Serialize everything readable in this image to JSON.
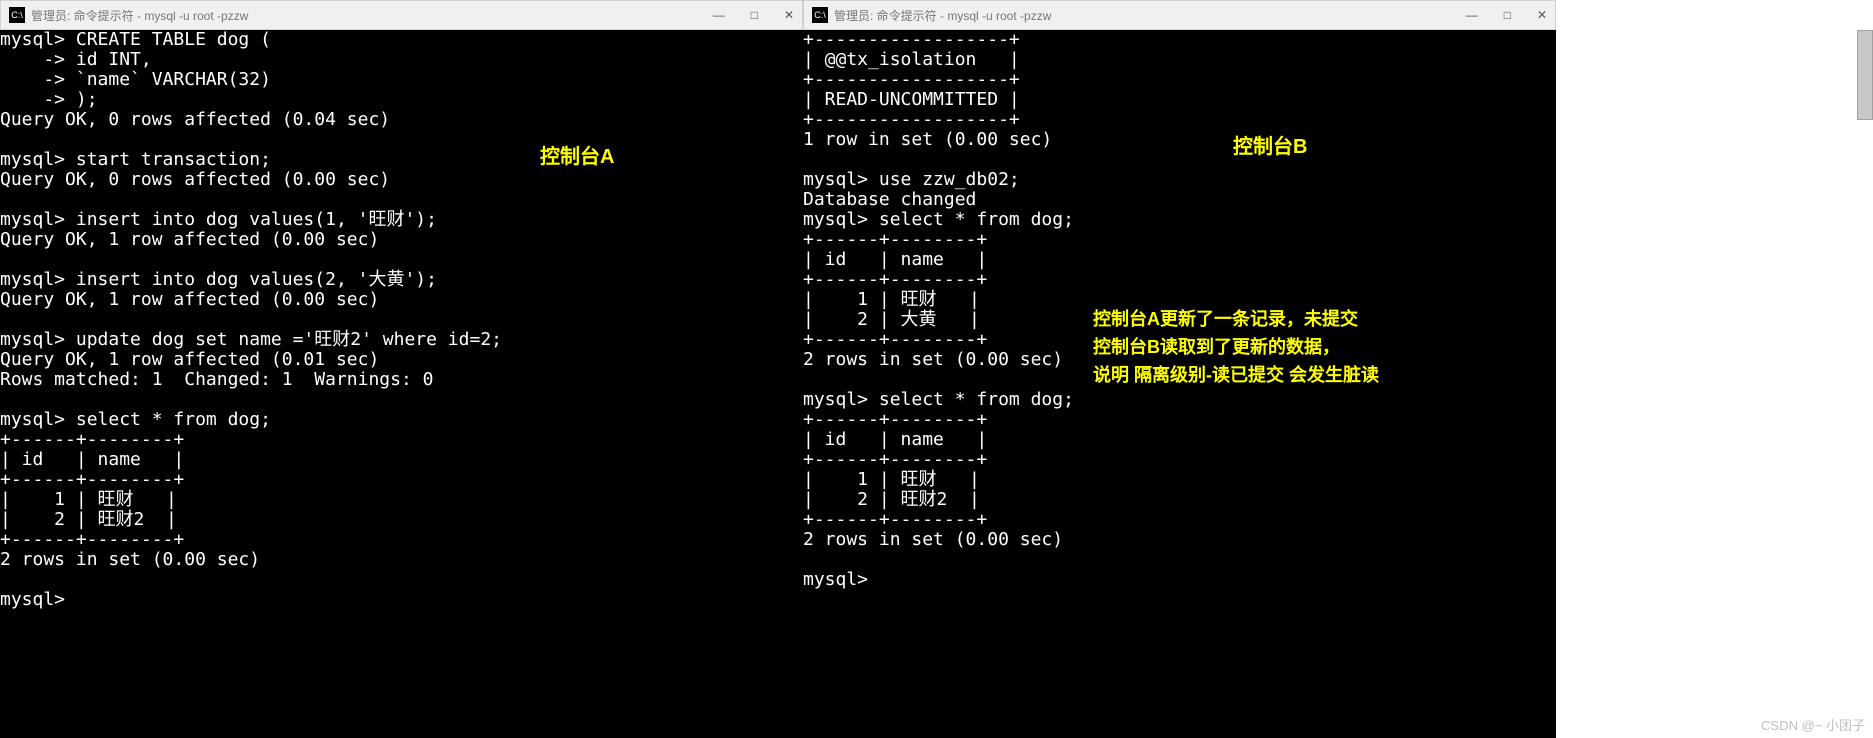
{
  "windowA": {
    "icon": "C:\\",
    "title": "管理员: 命令提示符 - mysql  -u root -pzzw",
    "min": "—",
    "max": "□",
    "close": "✕",
    "label": "控制台A",
    "content": "mysql> CREATE TABLE dog (\n    -> id INT,\n    -> `name` VARCHAR(32)\n    -> );\nQuery OK, 0 rows affected (0.04 sec)\n\nmysql> start transaction;\nQuery OK, 0 rows affected (0.00 sec)\n\nmysql> insert into dog values(1, '旺财');\nQuery OK, 1 row affected (0.00 sec)\n\nmysql> insert into dog values(2, '大黄');\nQuery OK, 1 row affected (0.00 sec)\n\nmysql> update dog set name ='旺财2' where id=2;\nQuery OK, 1 row affected (0.01 sec)\nRows matched: 1  Changed: 1  Warnings: 0\n\nmysql> select * from dog;\n+------+--------+\n| id   | name   |\n+------+--------+\n|    1 | 旺财   |\n|    2 | 旺财2  |\n+------+--------+\n2 rows in set (0.00 sec)\n\nmysql>"
  },
  "windowB": {
    "icon": "C:\\",
    "title": "管理员: 命令提示符 - mysql  -u root -pzzw",
    "min": "—",
    "max": "□",
    "close": "✕",
    "label": "控制台B",
    "content": "+------------------+\n| @@tx_isolation   |\n+------------------+\n| READ-UNCOMMITTED |\n+------------------+\n1 row in set (0.00 sec)\n\nmysql> use zzw_db02;\nDatabase changed\nmysql> select * from dog;\n+------+--------+\n| id   | name   |\n+------+--------+\n|    1 | 旺财   |\n|    2 | 大黄   |\n+------+--------+\n2 rows in set (0.00 sec)\n\nmysql> select * from dog;\n+------+--------+\n| id   | name   |\n+------+--------+\n|    1 | 旺财   |\n|    2 | 旺财2  |\n+------+--------+\n2 rows in set (0.00 sec)\n\nmysql>",
    "annotation": "控制台A更新了一条记录，未提交\n控制台B读取到了更新的数据，\n说明 隔离级别-读已提交 会发生脏读"
  },
  "watermark": "CSDN @~ 小团子"
}
